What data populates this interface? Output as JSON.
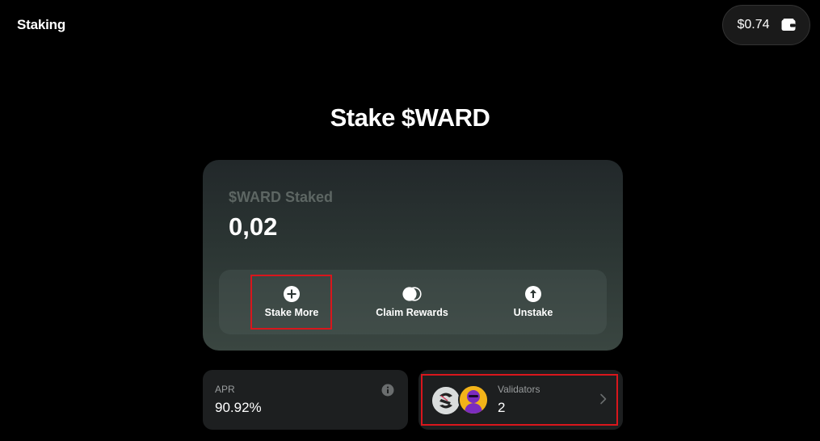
{
  "header": {
    "app_title": "Staking",
    "balance": "$0.74",
    "wallet_icon": "wallet-icon"
  },
  "main": {
    "title": "Stake $WARD",
    "staked": {
      "label": "$WARD Staked",
      "value": "0,02"
    },
    "actions": [
      {
        "label": "Stake More",
        "icon": "plus-circle-icon"
      },
      {
        "label": "Claim Rewards",
        "icon": "coins-icon"
      },
      {
        "label": "Unstake",
        "icon": "arrow-up-circle-icon"
      }
    ]
  },
  "stats": {
    "apr": {
      "label": "APR",
      "value": "90.92%",
      "icon": "info-icon"
    },
    "validators": {
      "label": "Validators",
      "value": "2",
      "icon": "chevron-right-icon"
    }
  },
  "colors": {
    "background": "#000000",
    "highlight": "#d9161c",
    "card": "#1d1f20"
  }
}
